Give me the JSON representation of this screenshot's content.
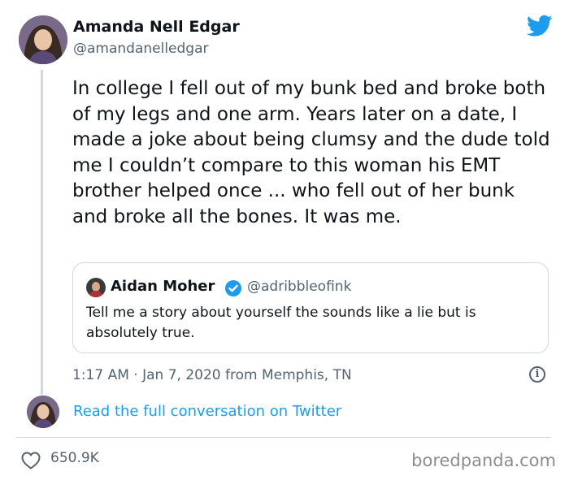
{
  "author": {
    "name": "Amanda Nell Edgar",
    "handle": "@amandanelledgar"
  },
  "tweet": {
    "text": "In college I fell out of my bunk bed and broke both of my legs and one arm. Years later on a date, I made a joke about being clumsy and the dude told me I couldn’t compare to this woman his EMT brother helped once ... who fell out of her bunk and broke all the bones. It was me.",
    "timestamp": "1:17 AM · Jan 7, 2020 from Memphis, TN"
  },
  "quoted_tweet": {
    "name": "Aidan Moher",
    "handle": "@adribbleofink",
    "text": "Tell me a story about yourself the sounds like a lie but is absolutely true."
  },
  "footer": {
    "read_link": "Read the full conversation on Twitter",
    "likes": "650.9K"
  },
  "watermark": "boredpanda.com",
  "icons": {
    "logo": "twitter-bird-icon",
    "verified": "verified-badge-icon",
    "info": "info-icon",
    "like": "heart-icon"
  },
  "colors": {
    "accent": "#1d9bf0",
    "text": "#0f1419",
    "muted": "#536471",
    "border": "#cfd9de"
  }
}
